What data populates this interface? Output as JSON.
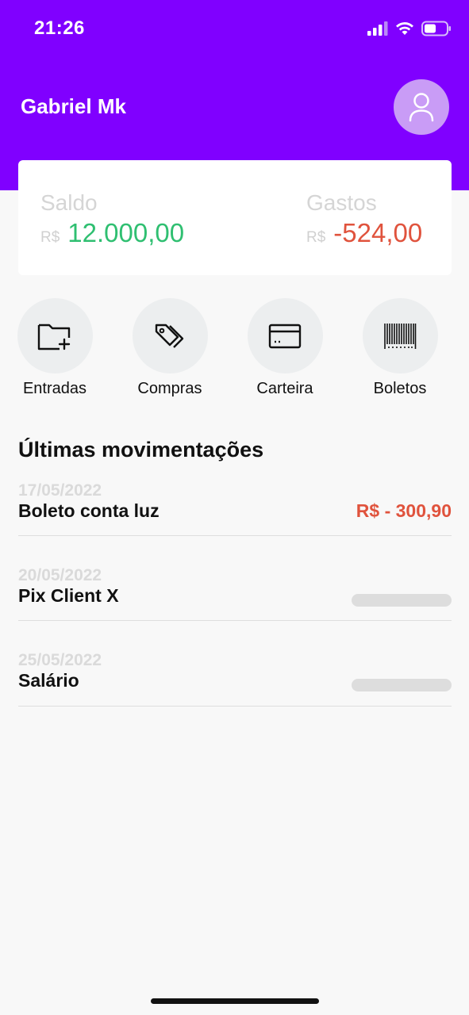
{
  "status_bar": {
    "time": "21:26"
  },
  "header": {
    "user_name": "Gabriel Mk"
  },
  "balance": {
    "saldo_label": "Saldo",
    "saldo_currency": "R$",
    "saldo_value": "12.000,00",
    "gastos_label": "Gastos",
    "gastos_currency": "R$",
    "gastos_value": "-524,00"
  },
  "actions": [
    {
      "label": "Entradas",
      "icon": "folder-plus-icon"
    },
    {
      "label": "Compras",
      "icon": "tags-icon"
    },
    {
      "label": "Carteira",
      "icon": "credit-card-icon"
    },
    {
      "label": "Boletos",
      "icon": "barcode-icon"
    }
  ],
  "transactions_title": "Últimas movimentações",
  "transactions": [
    {
      "date": "17/05/2022",
      "title": "Boleto conta luz",
      "amount": "R$ - 300,90"
    },
    {
      "date": "20/05/2022",
      "title": "Pix Client X",
      "amount": null
    },
    {
      "date": "25/05/2022",
      "title": "Salário",
      "amount": null
    }
  ],
  "colors": {
    "primary": "#8000ff",
    "positive": "#2fbf71",
    "negative": "#e0533d"
  }
}
